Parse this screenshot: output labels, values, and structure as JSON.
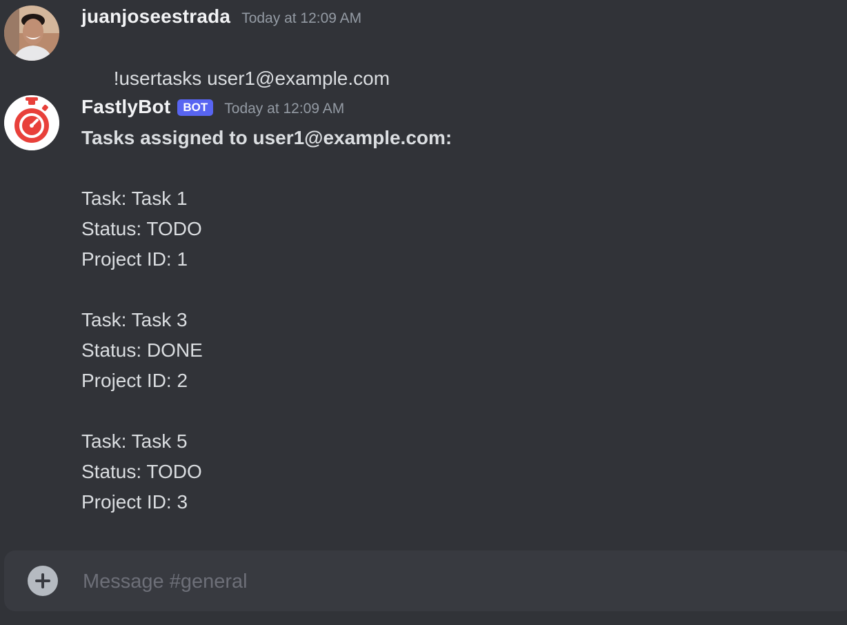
{
  "messages": [
    {
      "username": "juanjoseestrada",
      "timestamp": "Today at 12:09 AM",
      "avatar_icon": "user-photo-avatar",
      "text": "!usertasks user1@example.com"
    },
    {
      "username": "FastlyBot",
      "bot_tag": "BOT",
      "timestamp": "Today at 12:09 AM",
      "avatar_icon": "stopwatch-icon",
      "heading": "Tasks assigned to user1@example.com:",
      "tasks": [
        {
          "task": "Task: Task 1",
          "status": "Status: TODO",
          "project": "Project ID: 1"
        },
        {
          "task": "Task: Task 3",
          "status": "Status: DONE",
          "project": "Project ID: 2"
        },
        {
          "task": "Task: Task 5",
          "status": "Status: TODO",
          "project": "Project ID: 3"
        }
      ]
    }
  ],
  "composer": {
    "add_icon": "plus-circle-icon",
    "placeholder": "Message #general",
    "value": ""
  },
  "colors": {
    "background": "#313338",
    "composer": "#383a40",
    "bot_tag": "#5865f2",
    "bot_avatar_red": "#e8403a"
  }
}
